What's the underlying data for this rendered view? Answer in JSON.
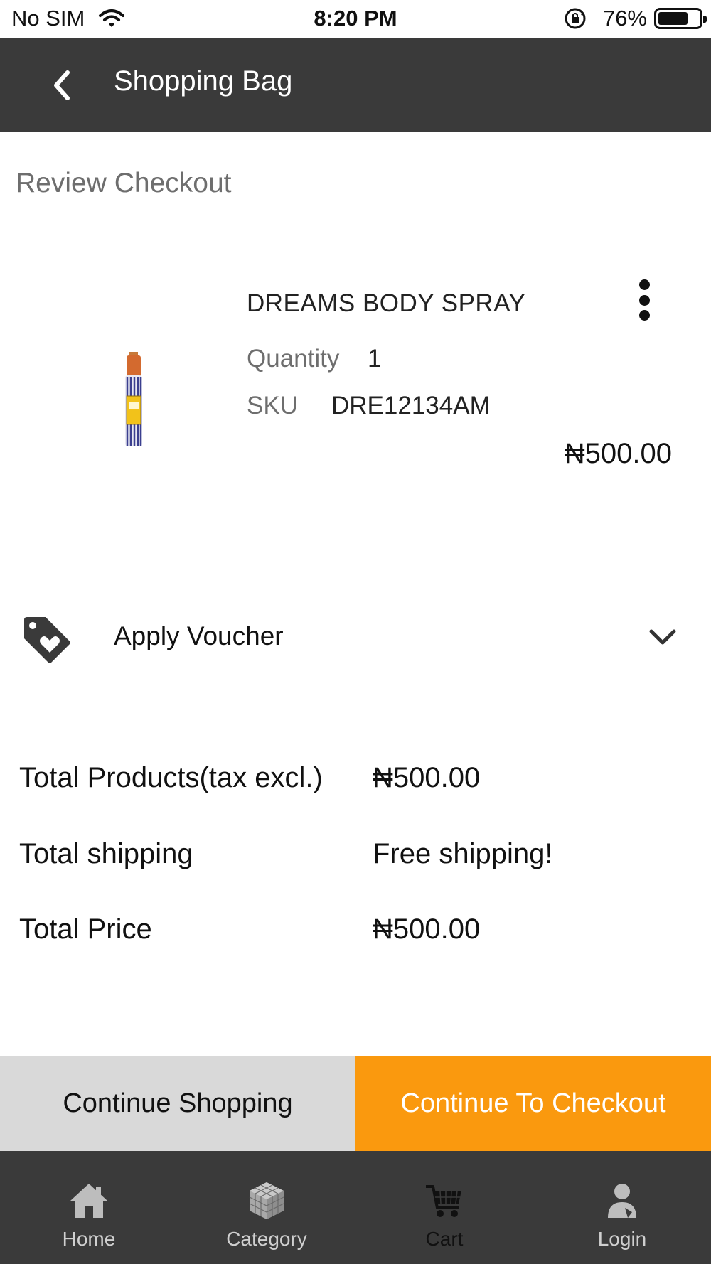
{
  "status_bar": {
    "carrier": "No SIM",
    "time": "8:20 PM",
    "battery_percent": "76%",
    "battery_level": 0.76
  },
  "header": {
    "title": "Shopping Bag",
    "back_icon": "chevron-left-icon"
  },
  "review": {
    "heading": "Review Checkout"
  },
  "product": {
    "name": "DREAMS BODY SPRAY",
    "quantity_label": "Quantity",
    "quantity_value": "1",
    "sku_label": "SKU",
    "sku_value": "DRE12134AM",
    "price": "₦500.00",
    "more_icon": "more-vertical-icon"
  },
  "voucher": {
    "label": "Apply Voucher",
    "icon": "tag-heart-icon",
    "expand_icon": "chevron-down-icon"
  },
  "totals": [
    {
      "label": "Total Products(tax excl.)",
      "value": "₦500.00"
    },
    {
      "label": "Total shipping",
      "value": "Free shipping!"
    },
    {
      "label": "Total Price",
      "value": "₦500.00"
    }
  ],
  "actions": {
    "continue_shopping": "Continue Shopping",
    "continue_checkout": "Continue To Checkout"
  },
  "tab_bar": {
    "items": [
      {
        "label": "Home",
        "icon": "home-icon"
      },
      {
        "label": "Category",
        "icon": "cube-icon"
      },
      {
        "label": "Cart",
        "icon": "cart-icon",
        "active": true
      },
      {
        "label": "Login",
        "icon": "user-icon"
      }
    ]
  },
  "colors": {
    "header_bg": "#3a3a3a",
    "checkout_orange": "#fa990e",
    "secondary_button": "#d9d9d9"
  }
}
